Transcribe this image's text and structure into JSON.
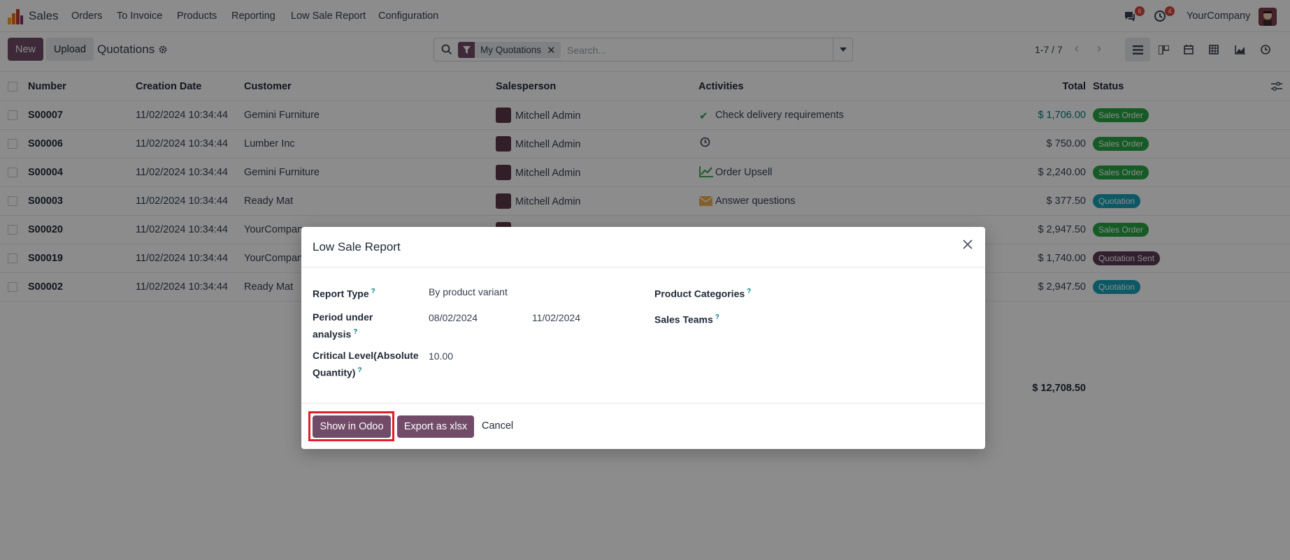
{
  "nav": {
    "app_name": "Sales",
    "menu": [
      "Orders",
      "To Invoice",
      "Products",
      "Reporting",
      "Low Sale Report",
      "Configuration"
    ],
    "messages_count": "6",
    "activities_count": "4",
    "company": "YourCompany"
  },
  "control": {
    "new_label": "New",
    "upload_label": "Upload",
    "title": "Quotations",
    "facet_label": "My Quotations",
    "search_placeholder": "Search...",
    "pager": "1-7 / 7"
  },
  "list": {
    "headers": {
      "number": "Number",
      "creation_date": "Creation Date",
      "customer": "Customer",
      "salesperson": "Salesperson",
      "activities": "Activities",
      "total": "Total",
      "status": "Status"
    },
    "rows": [
      {
        "number": "S00007",
        "date": "11/02/2024 10:34:44",
        "customer": "Gemini Furniture",
        "salesperson": "Mitchell Admin",
        "activity": "Check delivery requirements",
        "activity_icon": "check-icon",
        "total": "$ 1,706.00",
        "status": "Sales Order",
        "status_color": "#28a745"
      },
      {
        "number": "S00006",
        "date": "11/02/2024 10:34:44",
        "customer": "Lumber Inc",
        "salesperson": "Mitchell Admin",
        "activity": "",
        "activity_icon": "clock-icon",
        "total": "$ 750.00",
        "status": "Sales Order",
        "status_color": "#28a745"
      },
      {
        "number": "S00004",
        "date": "11/02/2024 10:34:44",
        "customer": "Gemini Furniture",
        "salesperson": "Mitchell Admin",
        "activity": "Order Upsell",
        "activity_icon": "chart-icon",
        "total": "$ 2,240.00",
        "status": "Sales Order",
        "status_color": "#28a745"
      },
      {
        "number": "S00003",
        "date": "11/02/2024 10:34:44",
        "customer": "Ready Mat",
        "salesperson": "Mitchell Admin",
        "activity": "Answer questions",
        "activity_icon": "envelope-icon",
        "total": "$ 377.50",
        "status": "Quotation",
        "status_color": "#17a2b8"
      },
      {
        "number": "S00020",
        "date": "11/02/2024 10:34:44",
        "customer": "YourCompany",
        "salesperson": "",
        "activity": "",
        "activity_icon": "",
        "total": "$ 2,947.50",
        "status": "Sales Order",
        "status_color": "#28a745"
      },
      {
        "number": "S00019",
        "date": "11/02/2024 10:34:44",
        "customer": "YourCompany",
        "salesperson": "",
        "activity": "",
        "activity_icon": "",
        "total": "$ 1,740.00",
        "status": "Quotation Sent",
        "status_color": "#5c3b55"
      },
      {
        "number": "S00002",
        "date": "11/02/2024 10:34:44",
        "customer": "Ready Mat",
        "salesperson": "",
        "activity": "",
        "activity_icon": "",
        "total": "$ 2,947.50",
        "status": "Quotation",
        "status_color": "#17a2b8"
      }
    ],
    "grand_total": "$ 12,708.50"
  },
  "modal": {
    "title": "Low Sale Report",
    "report_type_label": "Report Type",
    "report_type_value": "By product variant",
    "period_label_line1": "Period under",
    "period_label_line2": "analysis",
    "period_from": "08/02/2024",
    "period_to": "11/02/2024",
    "critical_label_line1": "Critical Level(Absolute",
    "critical_label_line2": "Quantity)",
    "critical_value": "10.00",
    "product_categories_label": "Product Categories",
    "sales_teams_label": "Sales Teams",
    "show_label": "Show in Odoo",
    "export_label": "Export as xlsx",
    "cancel_label": "Cancel"
  }
}
